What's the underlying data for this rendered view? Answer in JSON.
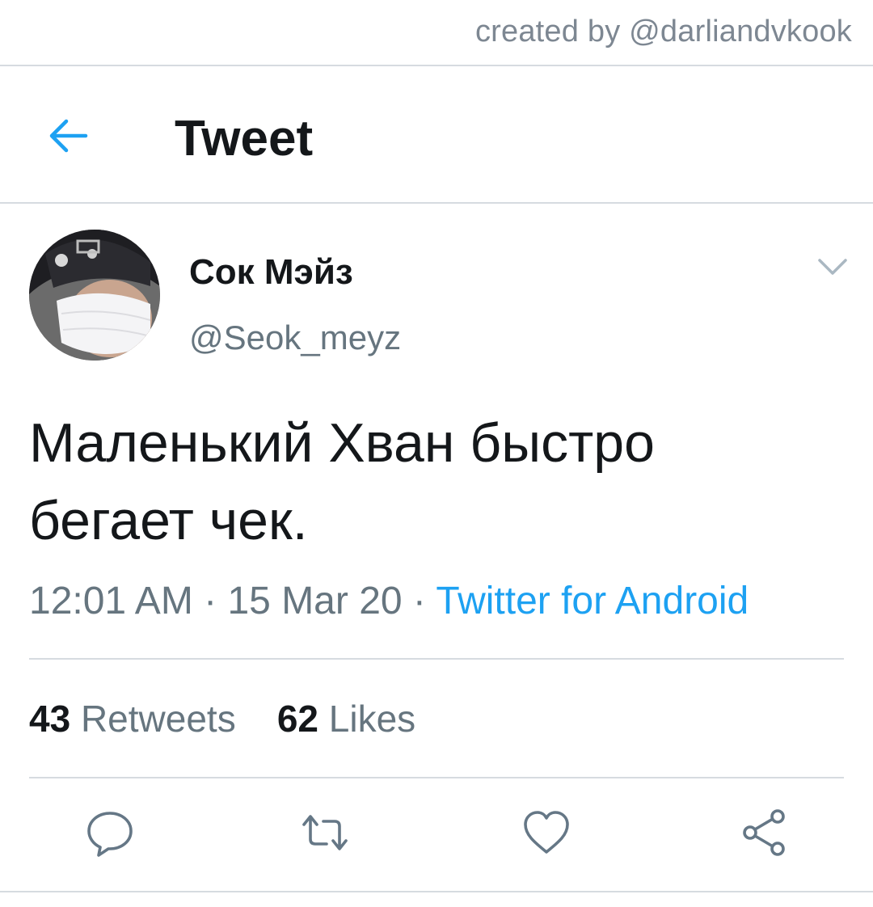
{
  "watermark": "created by @darliandvkook",
  "header": {
    "title": "Tweet",
    "back_icon": "arrow-left-icon",
    "accent": "#1da1f2"
  },
  "author": {
    "display_name": "Сок Мэйз",
    "handle": "@Seok_meyz",
    "menu_icon": "chevron-down-icon"
  },
  "tweet": {
    "text_line1": "Маленький Хван быстро",
    "text_line2": "бегает чек.",
    "time": "12:01 AM",
    "date": "15 Mar 20",
    "separator": " · ",
    "source": "Twitter for Android"
  },
  "stats": {
    "retweets_count": "43",
    "retweets_label": "Retweets",
    "likes_count": "62",
    "likes_label": "Likes"
  },
  "actions": [
    {
      "icon": "reply-icon"
    },
    {
      "icon": "retweet-icon"
    },
    {
      "icon": "heart-icon"
    },
    {
      "icon": "share-icon"
    }
  ],
  "colors": {
    "text": "#14171a",
    "secondary": "#66757f",
    "link": "#1da1f2",
    "divider": "#d6dbe0"
  }
}
